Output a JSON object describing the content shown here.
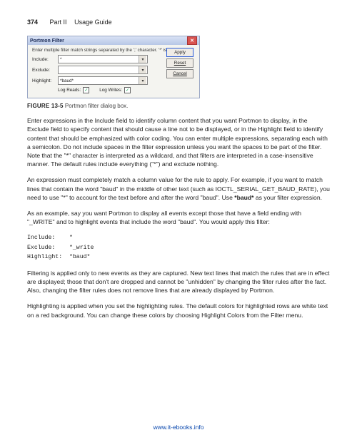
{
  "header": {
    "page_number": "374",
    "part": "Part II",
    "section": "Usage Guide"
  },
  "dialog": {
    "title": "Portmon Filter",
    "instruction": "Enter multiple filter match strings separated by the ';' character. '*' is a wildcard.",
    "fields": {
      "include": {
        "label": "Include:",
        "value": "*"
      },
      "exclude": {
        "label": "Exclude:",
        "value": ""
      },
      "highlight": {
        "label": "Highlight:",
        "value": "*baud*"
      }
    },
    "buttons": {
      "apply": "Apply",
      "reset": "Reset",
      "cancel": "Cancel"
    },
    "checks": {
      "log_reads": "Log Reads:",
      "log_writes": "Log Writes:"
    }
  },
  "caption": {
    "label": "FIGURE 13-5",
    "text": "Portmon filter dialog box."
  },
  "paras": {
    "p1": "Enter expressions in the Include field to identify column content that you want Portmon to display, in the Exclude field to specify content that should cause a line not to be displayed, or in the Highlight field to identify content that should be emphasized with color coding. You can enter multiple expressions, separating each with a semicolon. Do not include spaces in the filter expression unless you want the spaces to be part of the filter. Note that the \"*\" character is interpreted as a wildcard, and that filters are interpreted in a case-insensitive manner. The default rules include everything (\"*\") and exclude nothing.",
    "p2a": "An expression must completely match a column value for the rule to apply. For example, if you want to match lines that contain the word \"baud\" in the middle of other text (such as IOCTL_SERIAL_GET_BAUD_RATE), you need to use \"*\" to account for the text before and after the word \"baud\". Use ",
    "p2bold": "*baud*",
    "p2b": " as your filter expression.",
    "p3": "As an example, say you want Portmon to display all events except those that have a field ending with \"_WRITE\" and to highlight events that include the word \"baud\". You would apply this filter:",
    "p4": "Filtering is applied only to new events as they are captured. New text lines that match the rules that are in effect are displayed; those that don't are dropped and cannot be \"unhidden\" by changing the filter rules after the fact. Also, changing the filter rules does not remove lines that are already displayed by Portmon.",
    "p5": "Highlighting is applied when you set the highlighting rules. The default colors for highlighted rows are white text on a red background. You can change these colors by choosing Highlight Colors from the Filter menu."
  },
  "code": {
    "l1": "Include:    *",
    "l2": "Exclude:    *_write",
    "l3": "Highlight:  *baud*"
  },
  "footer": {
    "link": "www.it-ebooks.info"
  }
}
